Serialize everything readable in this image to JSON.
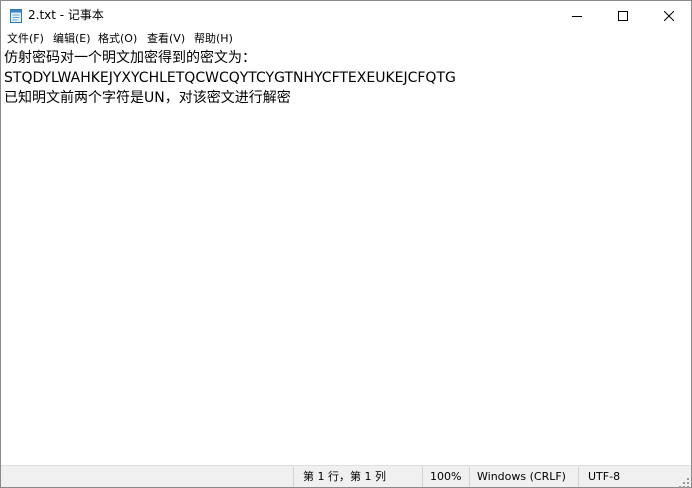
{
  "window": {
    "title": "2.txt - 记事本"
  },
  "menu": {
    "items": [
      "文件(F)",
      "编辑(E)",
      "格式(O)",
      "查看(V)",
      "帮助(H)"
    ]
  },
  "document": {
    "lines": [
      "仿射密码对一个明文加密得到的密文为：",
      "STQDYLWAHKEJYXYCHLETQCWCQYTCYGTNHYCFTEXEUKEJCFQTG",
      "已知明文前两个字符是UN，对该密文进行解密"
    ]
  },
  "status": {
    "position": "第 1 行，第 1 列",
    "zoom": "100%",
    "line_ending": "Windows (CRLF)",
    "encoding": "UTF-8"
  },
  "icons": {
    "app": "notepad-icon",
    "minimize": "minimize-icon",
    "maximize": "maximize-icon",
    "close": "close-icon",
    "grip": "resize-grip-icon"
  }
}
